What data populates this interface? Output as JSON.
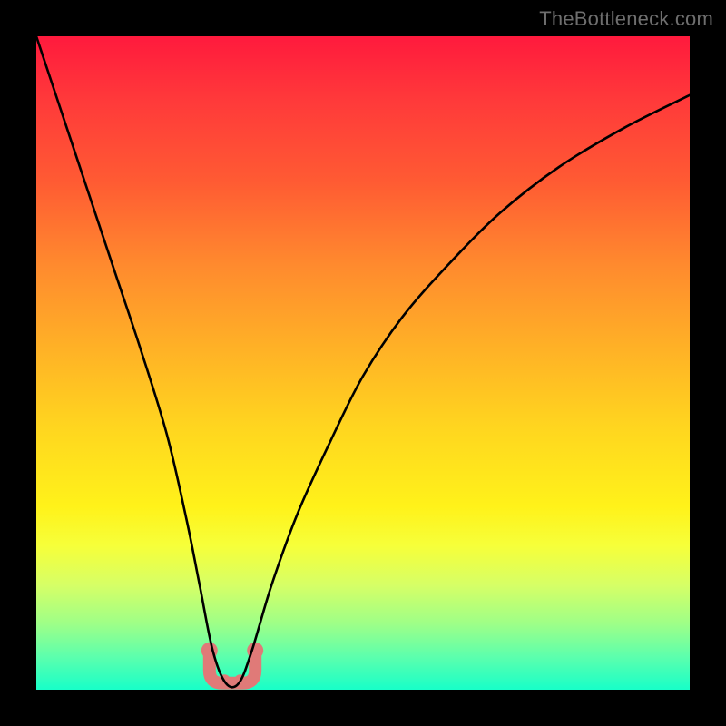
{
  "watermark": "TheBottleneck.com",
  "chart_data": {
    "type": "line",
    "title": "",
    "xlabel": "",
    "ylabel": "",
    "xlim": [
      0,
      100
    ],
    "ylim": [
      0,
      100
    ],
    "grid": false,
    "legend": false,
    "background": "rainbow-gradient-vertical",
    "series": [
      {
        "name": "bottleneck-curve",
        "color": "#000000",
        "x": [
          0,
          4,
          8,
          12,
          16,
          20,
          23,
          25,
          27,
          29,
          31,
          33,
          36,
          40,
          45,
          50,
          56,
          63,
          71,
          80,
          90,
          100
        ],
        "values": [
          100,
          88,
          76,
          64,
          52,
          39,
          26,
          16,
          6,
          1,
          1,
          6,
          16,
          27,
          38,
          48,
          57,
          65,
          73,
          80,
          86,
          91
        ]
      }
    ],
    "annotations": [
      {
        "name": "sweet-spot-bracket",
        "type": "u-bracket",
        "color": "#e07a78",
        "x_range": [
          26.5,
          33.5
        ],
        "y_top": 6,
        "y_bottom": 1,
        "endpoint_dots": true
      }
    ]
  }
}
